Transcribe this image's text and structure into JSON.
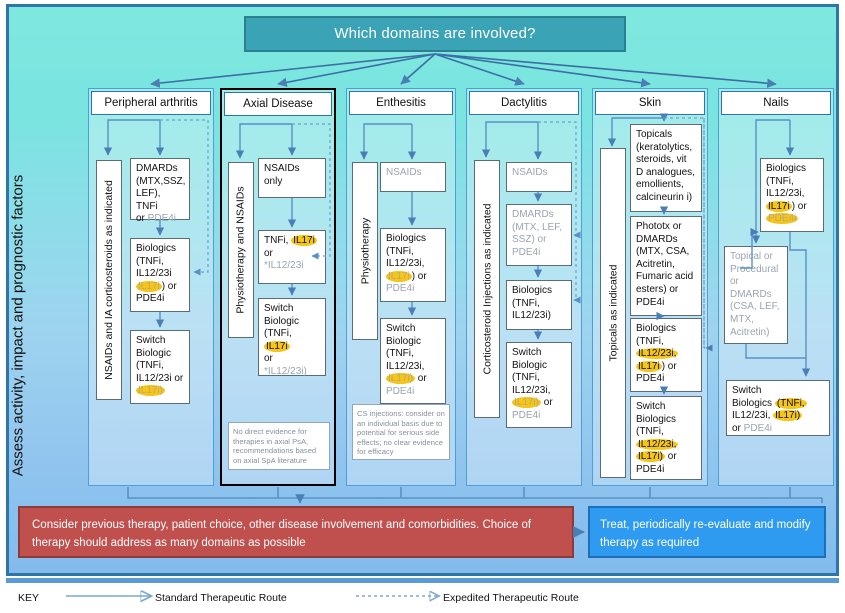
{
  "title": "Which domains are involved?",
  "left_axis_label": "Assess activity, impact and prognostic factors",
  "columns": [
    {
      "id": "peripheral-arthritis",
      "header": "Peripheral arthritis",
      "side_label": "NSAIDs and IA corticosteroids as indicated",
      "boxes": [
        {
          "id": "pa-1",
          "lines": [
            "DMARDs",
            "(MTX,SSZ,",
            "LEF), TNFi",
            "or PDE4i"
          ]
        },
        {
          "id": "pa-2",
          "lines": [
            "Biologics",
            "(TNFi,",
            "IL12/23i",
            "IL17i) or",
            "PDE4i"
          ]
        },
        {
          "id": "pa-3",
          "lines": [
            "Switch",
            "Biologic",
            "(TNFi,",
            "IL12/23i or",
            "IL17i)"
          ]
        }
      ],
      "note": ""
    },
    {
      "id": "axial-disease",
      "header": "Axial Disease",
      "side_label": "Physiotherapy and NSAIDs",
      "boxes": [
        {
          "id": "ax-1",
          "lines": [
            "NSAIDs only"
          ]
        },
        {
          "id": "ax-2",
          "lines": [
            "TNFi, IL17i",
            "or",
            "*IL12/23i"
          ]
        },
        {
          "id": "ax-3",
          "lines": [
            "Switch",
            "Biologic",
            "(TNFi, IL17i",
            "or",
            "*IL12/23i)"
          ]
        }
      ],
      "note": "No direct evidence for therapies in axial PsA, recommendations based on axial SpA literature"
    },
    {
      "id": "enthesitis",
      "header": "Enthesitis",
      "side_label": "Physiotherapy",
      "boxes": [
        {
          "id": "en-1",
          "lines": [
            "NSAIDs"
          ]
        },
        {
          "id": "en-2",
          "lines": [
            "Biologics",
            "(TNFi,",
            "IL12/23i,",
            "IL17i) or",
            "PDE4i"
          ]
        },
        {
          "id": "en-3",
          "lines": [
            "Switch",
            "Biologic",
            "(TNFi,",
            "IL12/23i,",
            "IL17i) or",
            "PDE4i"
          ]
        }
      ],
      "note": "CS injections: consider on an individual basis due to potential for serious side effects; no clear evidence for efficacy"
    },
    {
      "id": "dactylitis",
      "header": "Dactylitis",
      "side_label": "Corticosteroid Injections as indicated",
      "boxes": [
        {
          "id": "da-1",
          "lines": [
            "NSAIDs"
          ]
        },
        {
          "id": "da-2",
          "lines": [
            "DMARDs",
            "(MTX, LEF,",
            "SSZ) or",
            "PDE4i"
          ]
        },
        {
          "id": "da-3",
          "lines": [
            "Biologics",
            "(TNFi,",
            "IL12/23i)"
          ]
        },
        {
          "id": "da-4",
          "lines": [
            "Switch",
            "Biologic",
            "(TNFi,",
            "IL12/23i,",
            "IL17i) or",
            "PDE4i"
          ]
        }
      ],
      "note": ""
    },
    {
      "id": "skin",
      "header": "Skin",
      "side_label": "Topicals as indicated",
      "boxes": [
        {
          "id": "sk-1",
          "lines": [
            "Topicals",
            "(keratolytics,",
            "steroids, vit",
            "D analogues,",
            "emollients,",
            "calcineurin i)"
          ]
        },
        {
          "id": "sk-2",
          "lines": [
            "Phototx or",
            "DMARDs",
            "(MTX, CSA,",
            "Acitretin,",
            "Fumaric acid",
            "esters) or",
            "PDE4i"
          ]
        },
        {
          "id": "sk-3",
          "lines": [
            "Biologics",
            "(TNFi,",
            "IL12/23i,",
            "IL17i) or",
            "PDE4i"
          ]
        },
        {
          "id": "sk-4",
          "lines": [
            "Switch",
            "Biologics",
            "(TNFi,",
            "IL12/23i,",
            "IL17i) or",
            "PDE4i"
          ]
        }
      ],
      "note": ""
    },
    {
      "id": "nails",
      "header": "Nails",
      "side_label": "",
      "boxes": [
        {
          "id": "na-1",
          "lines": [
            "Biologics",
            "(TNFi,",
            "IL12/23i,",
            "IL17i) or",
            "PDE4i"
          ]
        },
        {
          "id": "na-2",
          "lines": [
            "Topical or",
            "Procedural",
            "or",
            "DMARDs",
            "(CSA, LEF,",
            "MTX,",
            "Acitretin)"
          ]
        },
        {
          "id": "na-3",
          "lines": [
            "Switch",
            "Biologics (TNFi,",
            "IL12/23i, IL17i)",
            "or PDE4i"
          ]
        }
      ],
      "note": ""
    }
  ],
  "bottom": {
    "considerations": "Consider previous therapy, patient choice, other disease involvement and comorbidities.  Choice of therapy should address as many domains as possible",
    "treat": "Treat, periodically re-evaluate and modify therapy as required"
  },
  "key": {
    "label": "KEY",
    "standard": "Standard Therapeutic Route",
    "expedited": "Expedited Therapeutic Route"
  },
  "colors": {
    "title_bg": "#3aa3b5",
    "red_panel": "#c0504d",
    "blue_panel": "#2e9bf0",
    "highlight": "#f5c518",
    "arrow": "#4a7fb5"
  }
}
